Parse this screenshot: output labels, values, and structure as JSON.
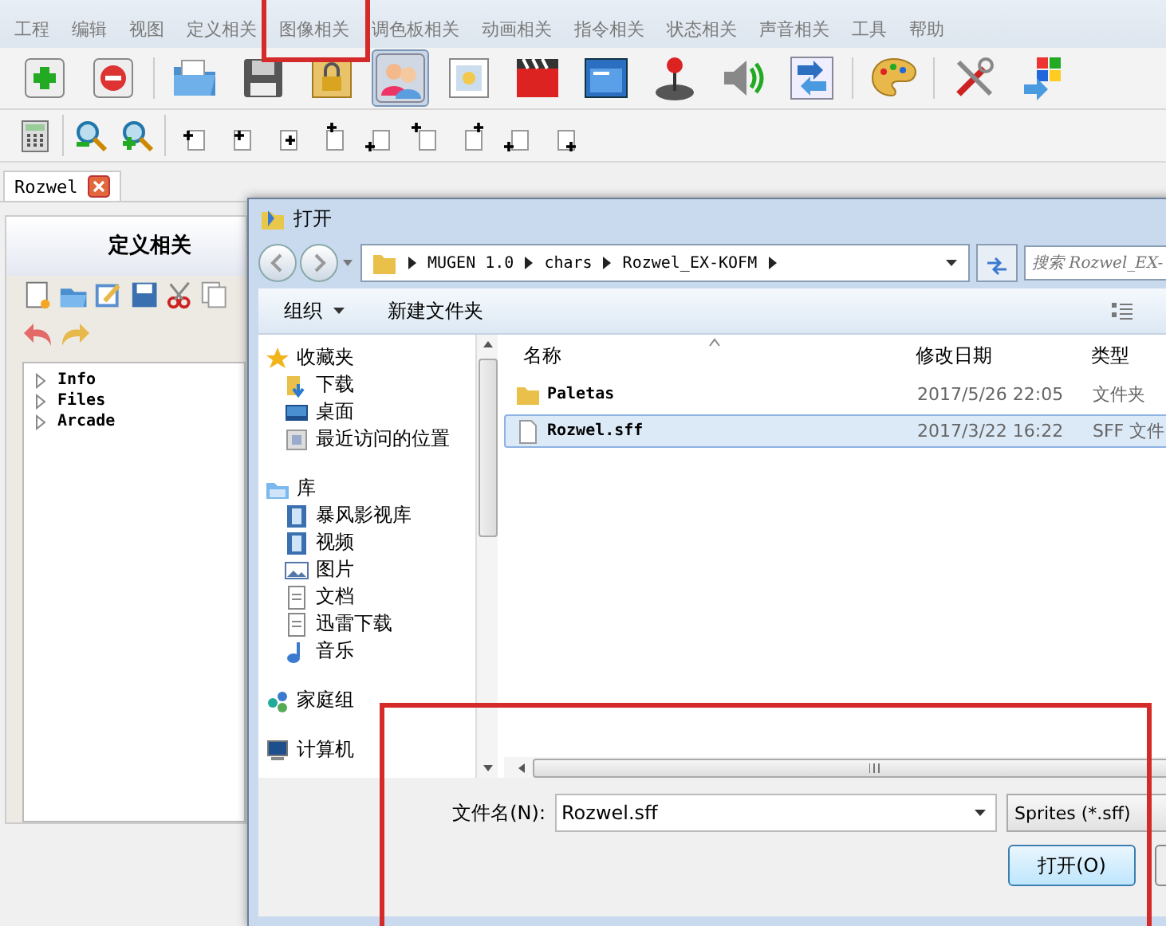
{
  "menu": [
    "工程",
    "编辑",
    "视图",
    "定义相关",
    "图像相关",
    "调色板相关",
    "动画相关",
    "指令相关",
    "状态相关",
    "声音相关",
    "工具",
    "帮助"
  ],
  "tabs": [
    {
      "label": "Rozwel",
      "selected": true
    }
  ],
  "left_panel": {
    "title": "定义相关",
    "tree": [
      {
        "label": "Info",
        "expanded": false
      },
      {
        "label": "Files",
        "expanded": false
      },
      {
        "label": "Arcade",
        "expanded": false
      }
    ]
  },
  "dialog": {
    "title": "打开",
    "breadcrumb": [
      "MUGEN 1.0",
      "chars",
      "Rozwel_EX-KOFM"
    ],
    "search": {
      "placeholder": "搜索 Rozwel_EX-"
    },
    "toolbar": {
      "organize": "组织",
      "new_folder": "新建文件夹"
    },
    "nav": [
      {
        "label": "收藏夹",
        "kind": "star",
        "children": [
          {
            "label": "下载",
            "kind": "download"
          },
          {
            "label": "桌面",
            "kind": "desktop"
          },
          {
            "label": "最近访问的位置",
            "kind": "recent"
          }
        ]
      },
      {
        "label": "库",
        "kind": "library",
        "children": [
          {
            "label": "暴风影视库",
            "kind": "video"
          },
          {
            "label": "视频",
            "kind": "video"
          },
          {
            "label": "图片",
            "kind": "picture"
          },
          {
            "label": "文档",
            "kind": "document"
          },
          {
            "label": "迅雷下载",
            "kind": "document"
          },
          {
            "label": "音乐",
            "kind": "music"
          }
        ]
      },
      {
        "label": "家庭组",
        "kind": "homegroup"
      },
      {
        "label": "计算机",
        "kind": "computer"
      }
    ],
    "columns": [
      "名称",
      "修改日期",
      "类型"
    ],
    "rows": [
      {
        "name": "Paletas",
        "modified": "2017/5/26 22:05",
        "type": "文件夹",
        "kind": "folder",
        "selected": false
      },
      {
        "name": "Rozwel.sff",
        "modified": "2017/3/22 16:22",
        "type": "SFF 文件",
        "kind": "file",
        "selected": true
      }
    ],
    "filename_label": "文件名(N):",
    "filename": "Rozwel.sff",
    "filter": "Sprites (*.sff)",
    "open_button": "打开(O)"
  }
}
